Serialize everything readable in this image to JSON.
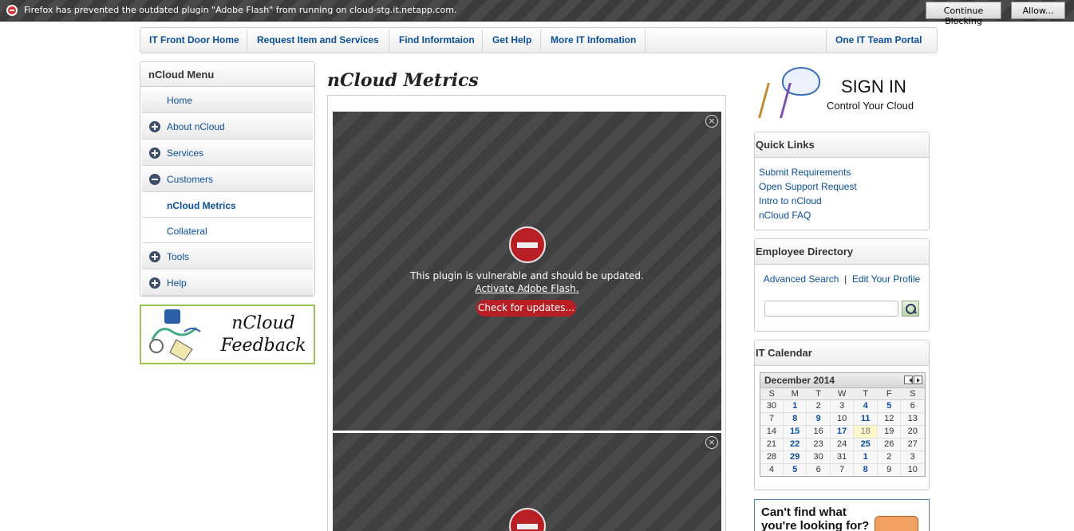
{
  "notification": {
    "message": "Firefox has prevented the outdated plugin \"Adobe Flash\" from running on cloud-stg.it.netapp.com.",
    "continue_label": "Continue Blocking",
    "allow_label": "Allow..."
  },
  "topnav": {
    "items": [
      "IT Front Door Home",
      "Request Item and Services",
      "Find Informtaion",
      "Get Help",
      "More IT Infomation"
    ],
    "right": "One IT Team Portal"
  },
  "leftmenu": {
    "title": "nCloud Menu",
    "items": [
      {
        "label": "Home",
        "icon": "none"
      },
      {
        "label": "About nCloud",
        "icon": "plus"
      },
      {
        "label": "Services",
        "icon": "plus"
      },
      {
        "label": "Customers",
        "icon": "minus"
      },
      {
        "label": "nCloud Metrics",
        "icon": "none"
      },
      {
        "label": "Collateral",
        "icon": "none"
      },
      {
        "label": "Tools",
        "icon": "plus"
      },
      {
        "label": "Help",
        "icon": "plus"
      }
    ]
  },
  "feedback": {
    "line1": "nCloud",
    "line2": "Feedback"
  },
  "main": {
    "title": "nCloud Metrics",
    "plugin": {
      "message": "This plugin is vulnerable and should be updated.",
      "activate": "Activate Adobe Flash.",
      "check": "Check for updates..."
    }
  },
  "signin": {
    "title": "SIGN IN",
    "subtitle": "Control Your Cloud"
  },
  "quicklinks": {
    "title": "Quick Links",
    "links": [
      "Submit Requirements",
      "Open Support Request",
      "Intro to nCloud",
      "nCloud FAQ"
    ]
  },
  "directory": {
    "title": "Employee Directory",
    "advanced": "Advanced Search",
    "sep": "|",
    "edit": "Edit Your Profile"
  },
  "calendar": {
    "title": "IT Calendar",
    "month": "December 2014",
    "days": [
      "S",
      "M",
      "T",
      "W",
      "T",
      "F",
      "S"
    ],
    "weeks": [
      [
        "30",
        "1",
        "2",
        "3",
        "4",
        "5",
        "6"
      ],
      [
        "7",
        "8",
        "9",
        "10",
        "11",
        "12",
        "13"
      ],
      [
        "14",
        "15",
        "16",
        "17",
        "18",
        "19",
        "20"
      ],
      [
        "21",
        "22",
        "23",
        "24",
        "25",
        "26",
        "27"
      ],
      [
        "28",
        "29",
        "30",
        "31",
        "1",
        "2",
        "3"
      ],
      [
        "4",
        "5",
        "6",
        "7",
        "8",
        "9",
        "10"
      ]
    ],
    "events": [
      [
        0,
        1
      ],
      [
        0,
        4
      ],
      [
        0,
        5
      ],
      [
        1,
        1
      ],
      [
        1,
        2
      ],
      [
        1,
        4
      ],
      [
        2,
        1
      ],
      [
        2,
        3
      ],
      [
        3,
        1
      ],
      [
        3,
        4
      ],
      [
        4,
        1
      ],
      [
        4,
        4
      ],
      [
        5,
        1
      ],
      [
        5,
        4
      ]
    ],
    "today": [
      2,
      4
    ]
  },
  "cantfind": {
    "line1": "Can't find what",
    "line2": "you're looking for?"
  },
  "colors": {
    "link": "#0b4f9b",
    "block_red": "#b81f24",
    "accent_green": "#9ac24e"
  }
}
